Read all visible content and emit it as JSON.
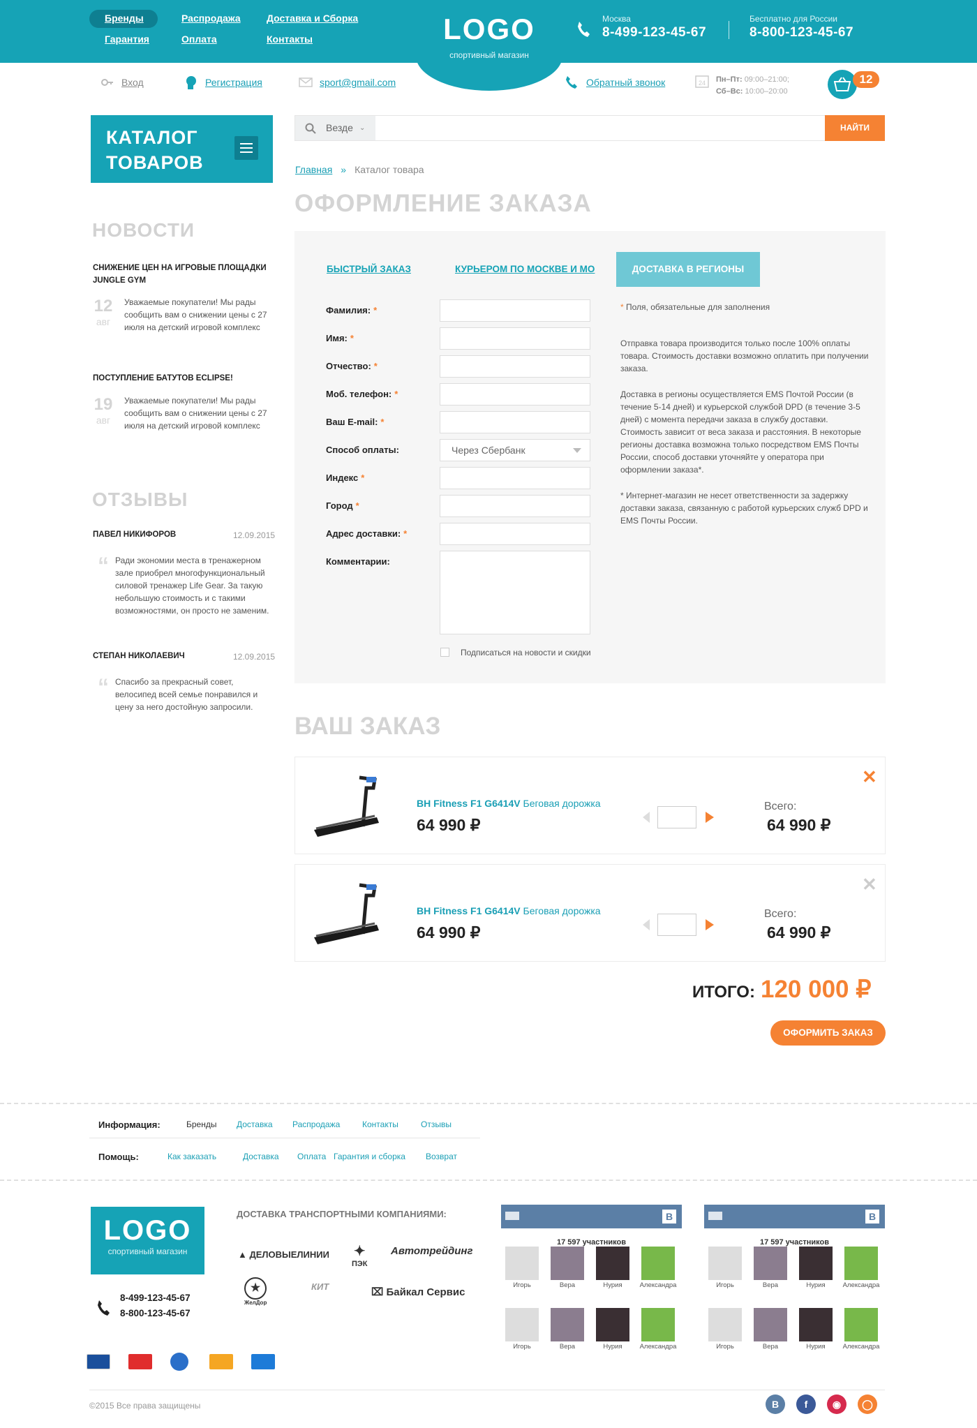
{
  "header": {
    "nav": [
      "Бренды",
      "Распродажа",
      "Доставка и Сборка",
      "Гарантия",
      "Оплата",
      "Контакты"
    ],
    "logo": "LOGO",
    "logo_sub": "спортивный магазин",
    "phone1": {
      "city": "Москва",
      "number": "8-499-123-45-67"
    },
    "phone2": {
      "city": "Бесплатно для России",
      "number": "8-800-123-45-67"
    }
  },
  "utility": {
    "login": "Вход",
    "register": "Регистрация",
    "email": "sport@gmail.com",
    "callback": "Обратный звонок",
    "hours1_label": "Пн–Пт:",
    "hours1": "09:00–21:00;",
    "hours2_label": "Сб–Вс:",
    "hours2": "10:00–20:00",
    "cart_count": "12"
  },
  "sidebar": {
    "catalog_line1": "КАТАЛОГ",
    "catalog_line2": "ТОВАРОВ",
    "news_title": "НОВОСТИ",
    "news": [
      {
        "title": "СНИЖЕНИЕ ЦЕН НА ИГРОВЫЕ ПЛОЩАДКИ JUNGLE GYM",
        "day": "12",
        "month": "авг",
        "text": "Уважаемые покупатели! Мы рады сообщить вам о снижении цены с 27 июля на детский игровой комплекс"
      },
      {
        "title": "ПОСТУПЛЕНИЕ БАТУТОВ ECLIPSE!",
        "day": "19",
        "month": "авг",
        "text": "Уважаемые покупатели! Мы рады сообщить вам о снижении цены с 27 июля на детский игровой комплекс"
      }
    ],
    "reviews_title": "ОТЗЫВЫ",
    "reviews": [
      {
        "name": "ПАВЕЛ НИКИФОРОВ",
        "date": "12.09.2015",
        "text": "Ради экономии места в тренажерном зале приобрел многофункциональный силовой тренажер Life Gear. За такую небольшую стоимость и с такими возможностями, он просто не заменим."
      },
      {
        "name": "СТЕПАН НИКОЛАЕВИЧ",
        "date": "12.09.2015",
        "text": "Спасибо за прекрасный совет, велосипед всей семье понравился и цену за него достойную запросили."
      }
    ]
  },
  "search": {
    "scope": "Везде",
    "button": "НАЙТИ"
  },
  "breadcrumb": {
    "home": "Главная",
    "current": "Каталог товара"
  },
  "page_title": "ОФОРМЛЕНИЕ ЗАКАЗА",
  "tabs": [
    "БЫСТРЫЙ ЗАКАЗ",
    "КУРЬЕРОМ ПО МОСКВЕ И МО",
    "ДОСТАВКА В РЕГИОНЫ"
  ],
  "form": {
    "fields": [
      "Фамилия:",
      "Имя:",
      "Отчество:",
      "Моб. телефон:",
      "Ваш E-mail:",
      "Способ оплаты:",
      "Индекс",
      "Город",
      "Адрес доставки:",
      "Комментарии:"
    ],
    "payment_value": "Через Сбербанк",
    "subscribe": "Подписаться на новости и скидки",
    "required_note": "Поля, обязательные для заполнения",
    "note1": "Отправка товара производится только после 100% оплаты товара. Стоимость доставки возможно оплатить при получении заказа.",
    "note2": "Доставка в регионы осуществляется EMS Почтой России (в течение 5-14 дней) и курьерской службой DPD (в течение 3-5 дней) с момента передачи заказа в службу доставки. Стоимость зависит от веса заказа и расстояния. В некоторые регионы доставка возможна только посредством EMS Почты России, способ доставки уточняйте у оператора при оформлении заказа*.",
    "note3": "* Интернет-магазин не несет ответственности за задержку доставки заказа, связанную с работой курьерских служб DPD и EMS Почты России."
  },
  "order": {
    "title": "ВАШ ЗАКАЗ",
    "items": [
      {
        "brand": "BH Fitness F1 G6414V",
        "kind": "Беговая дорожка",
        "price": "64 990 ₽",
        "total_label": "Всего:",
        "total": "64 990 ₽"
      },
      {
        "brand": "BH Fitness F1 G6414V",
        "kind": "Беговая дорожка",
        "price": "64 990 ₽",
        "total_label": "Всего:",
        "total": "64 990 ₽"
      }
    ],
    "total_label": "ИТОГО:",
    "total": "120 000 ₽",
    "submit": "ОФОРМИТЬ ЗАКАЗ"
  },
  "footer": {
    "info_label": "Информация:",
    "info_links": [
      "Бренды",
      "Доставка",
      "Распродажа",
      "Контакты",
      "Отзывы"
    ],
    "help_label": "Помощь:",
    "help_links": [
      "Как заказать",
      "Доставка",
      "Оплата",
      "Гарантия и сборка",
      "Возврат"
    ],
    "logo": "LOGO",
    "logo_sub": "спортивный магазин",
    "delivery_title": "ДОСТАВКА ТРАНСПОРТНЫМИ КОМПАНИЯМИ:",
    "carriers": [
      "ДЕЛОВЫЕЛИНИИ",
      "ПЭК",
      "Автотрейдинг",
      "ЖелДор",
      "КИТ",
      "Байкал Сервис"
    ],
    "phone1": "8-499-123-45-67",
    "phone2": "8-800-123-45-67",
    "vk_count": "17 597 участников",
    "vk_members": [
      "Игорь",
      "Вера",
      "Нурия",
      "Александра"
    ],
    "copyright": "©2015 Все права защищены"
  },
  "colors": {
    "accent": "#16a3b6",
    "orange": "#f58233"
  }
}
